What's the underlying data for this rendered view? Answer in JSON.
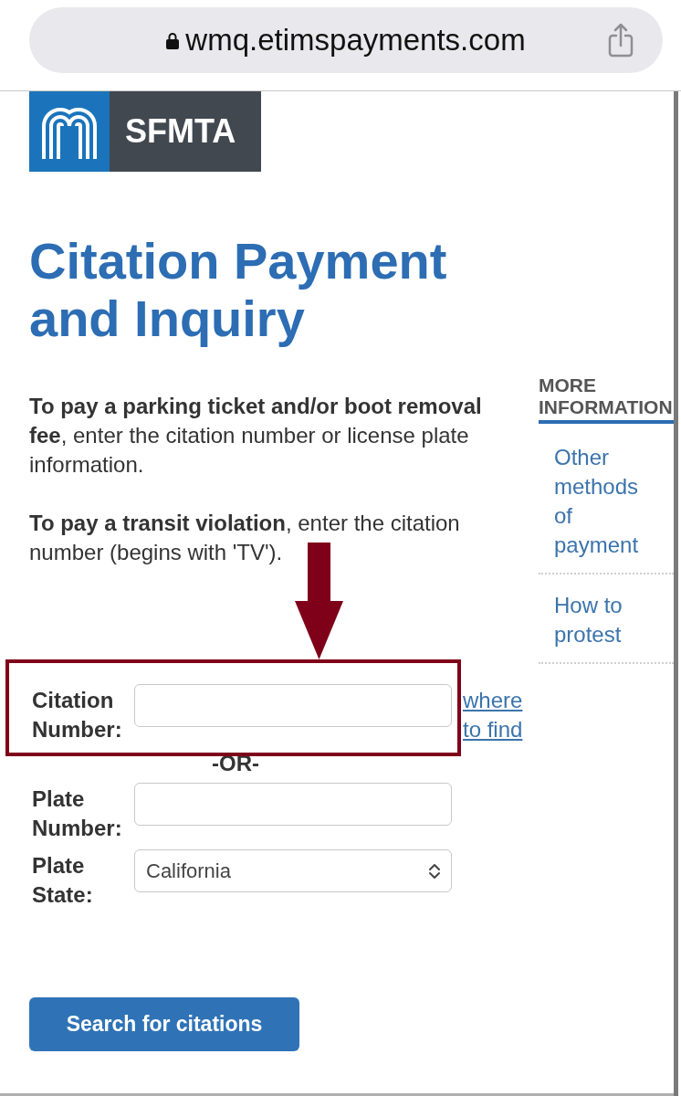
{
  "browser": {
    "url": "wmq.etimspayments.com"
  },
  "logo": {
    "text": "SFMTA"
  },
  "title": "Citation Payment and Inquiry",
  "intro": [
    "**To pay a parking ticket and/or boot removal fee**, enter the citation number or license plate information.",
    "**To pay a transit violation**, enter the citation number (begins with 'TV')."
  ],
  "sidebar": {
    "heading": "MORE INFORMATION",
    "links": [
      "Other methods of payment",
      "How to protest"
    ]
  },
  "form": {
    "rows": [
      {
        "kind": "input",
        "label": "Citation Number:",
        "help_link": "where to find",
        "highlighted": true
      },
      {
        "kind": "separator",
        "text": "-OR-"
      },
      {
        "kind": "input",
        "label": "Plate Number:",
        "highlighted": false
      },
      {
        "kind": "select",
        "label": "Plate State:",
        "value": "California",
        "highlighted": false
      }
    ],
    "submit": "Search for citations"
  }
}
